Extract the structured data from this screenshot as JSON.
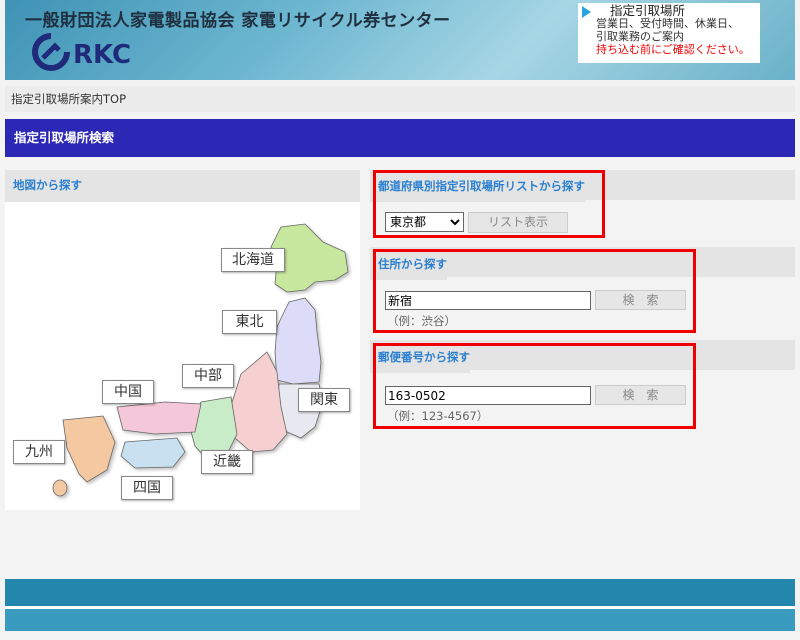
{
  "header": {
    "title": "一般財団法人家電製品協会 家電リサイクル券センター",
    "logo_text": "RKC",
    "notice": {
      "title": "指定引取場所",
      "line1": "営業日、受付時間、休業日、",
      "line2": "引取業務のご案内",
      "line3": "持ち込む前にご確認ください。"
    }
  },
  "breadcrumb": "指定引取場所案内TOP",
  "section_title": "指定引取場所検索",
  "map": {
    "heading": "地図から探す",
    "regions": {
      "hokkaido": "北海道",
      "tohoku": "東北",
      "kanto": "関東",
      "chubu": "中部",
      "chugoku": "中国",
      "kinki": "近畿",
      "kyushu": "九州",
      "shikoku": "四国"
    }
  },
  "pref_search": {
    "heading": "都道府県別指定引取場所リストから探す",
    "selected": "東京都",
    "button": "リスト表示"
  },
  "address_search": {
    "heading": "住所から探す",
    "value": "新宿",
    "hint": "（例：渋谷）",
    "button": "検　索"
  },
  "zip_search": {
    "heading": "郵便番号から探す",
    "value": "163-0502",
    "hint": "（例：123-4567）",
    "button": "検　索"
  },
  "colors": {
    "section_bar": "#2d27b5",
    "heading_text": "#2a7fd0",
    "highlight": "#e00000",
    "footer": "#2386ad"
  }
}
